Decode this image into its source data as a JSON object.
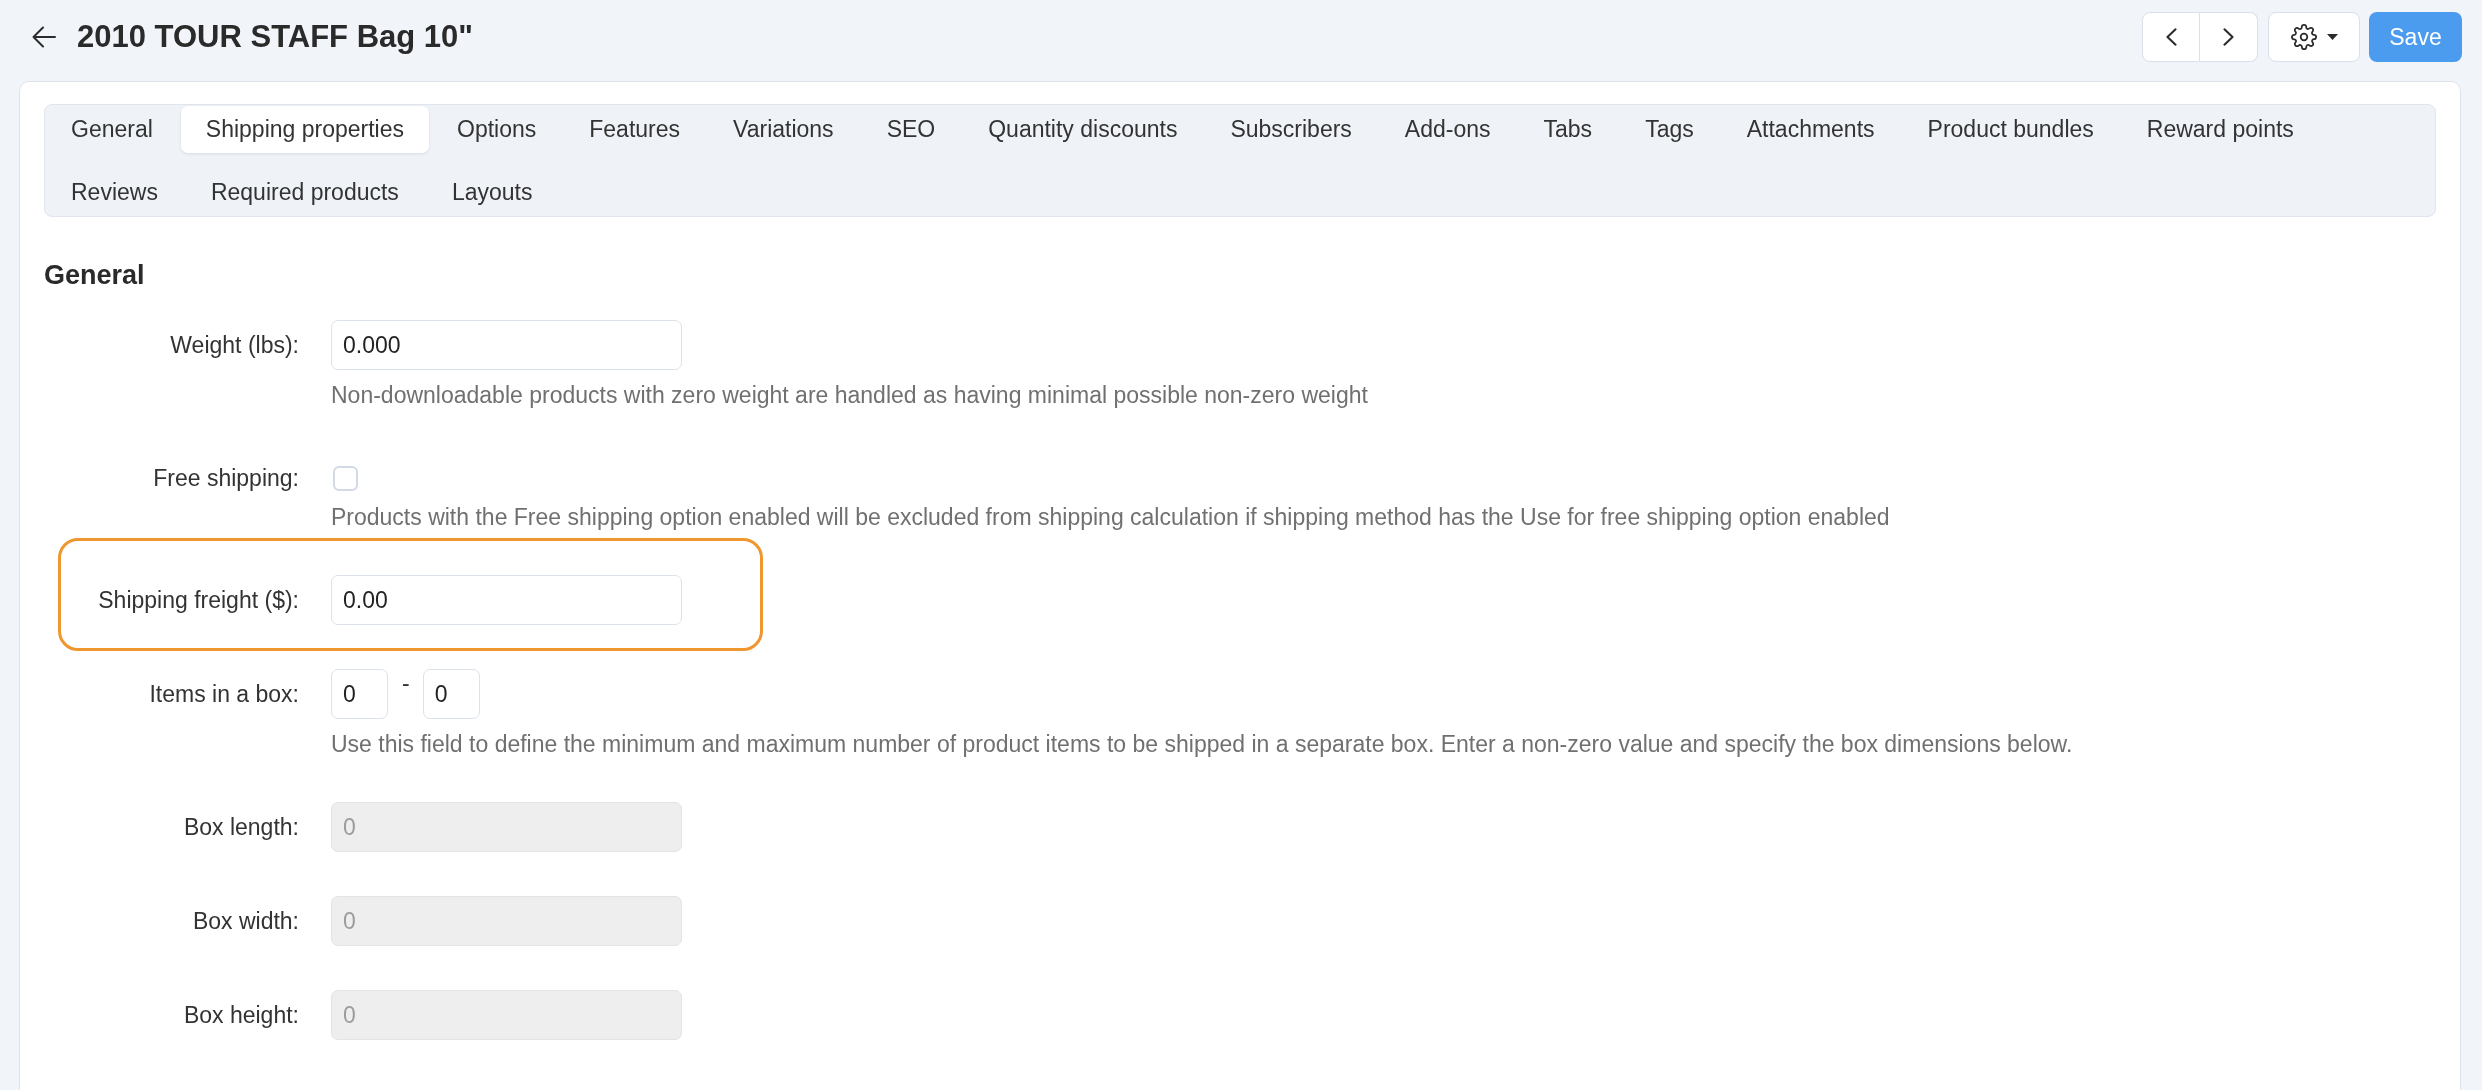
{
  "header": {
    "title": "2010 TOUR STAFF Bag 10\"",
    "save_button": "Save"
  },
  "tabs": [
    {
      "label": "General",
      "selected": false
    },
    {
      "label": "Shipping properties",
      "selected": true
    },
    {
      "label": "Options",
      "selected": false
    },
    {
      "label": "Features",
      "selected": false
    },
    {
      "label": "Variations",
      "selected": false
    },
    {
      "label": "SEO",
      "selected": false
    },
    {
      "label": "Quantity discounts",
      "selected": false
    },
    {
      "label": "Subscribers",
      "selected": false
    },
    {
      "label": "Add-ons",
      "selected": false
    },
    {
      "label": "Tabs",
      "selected": false
    },
    {
      "label": "Tags",
      "selected": false
    },
    {
      "label": "Attachments",
      "selected": false
    },
    {
      "label": "Product bundles",
      "selected": false
    },
    {
      "label": "Reward points",
      "selected": false
    },
    {
      "label": "Reviews",
      "selected": false
    },
    {
      "label": "Required products",
      "selected": false
    },
    {
      "label": "Layouts",
      "selected": false
    }
  ],
  "section": {
    "title": "General",
    "fields": [
      {
        "kind": "text",
        "label": "Weight (lbs):",
        "value": "0.000",
        "disabled": false,
        "highlighted": false,
        "help": "Non-downloadable products with zero weight are handled as having minimal possible non-zero weight"
      },
      {
        "kind": "checkbox",
        "label": "Free shipping:",
        "checked": false,
        "disabled": false,
        "highlighted": false,
        "help": "Products with the Free shipping option enabled will be excluded from shipping calculation if shipping method has the Use for free shipping option enabled"
      },
      {
        "kind": "text",
        "label": "Shipping freight ($):",
        "value": "0.00",
        "disabled": false,
        "highlighted": true
      },
      {
        "kind": "range",
        "label": "Items in a box:",
        "min_value": "0",
        "separator": "-",
        "max_value": "0",
        "disabled": false,
        "highlighted": false,
        "help": "Use this field to define the minimum and maximum number of product items to be shipped in a separate box. Enter a non-zero value and specify the box dimensions below."
      },
      {
        "kind": "text",
        "label": "Box length:",
        "value": "0",
        "disabled": true,
        "highlighted": false
      },
      {
        "kind": "text",
        "label": "Box width:",
        "value": "0",
        "disabled": true,
        "highlighted": false
      },
      {
        "kind": "text",
        "label": "Box height:",
        "value": "0",
        "disabled": true,
        "highlighted": false
      }
    ]
  }
}
